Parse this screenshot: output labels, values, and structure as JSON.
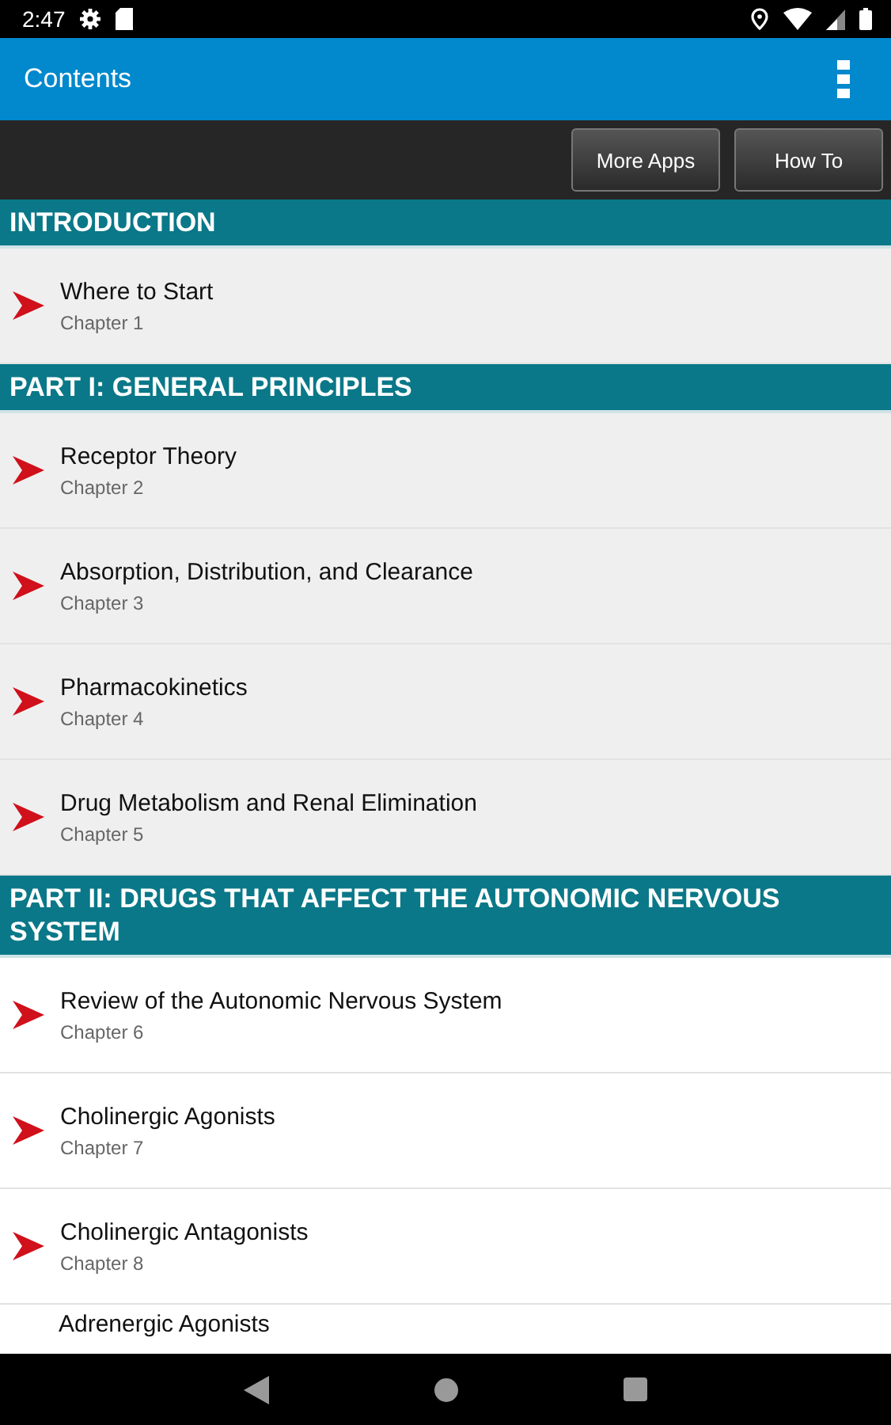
{
  "status_bar": {
    "time": "2:47"
  },
  "app_bar": {
    "title": "Contents"
  },
  "toolbar": {
    "buttons": [
      "More Apps",
      "How To"
    ]
  },
  "sections": [
    {
      "title": "INTRODUCTION",
      "shaded": true,
      "chapters": [
        {
          "title": "Where to Start",
          "subtitle": "Chapter 1"
        }
      ]
    },
    {
      "title": "PART I: GENERAL PRINCIPLES",
      "shaded": true,
      "chapters": [
        {
          "title": "Receptor Theory",
          "subtitle": "Chapter 2"
        },
        {
          "title": "Absorption, Distribution, and Clearance",
          "subtitle": "Chapter 3"
        },
        {
          "title": "Pharmacokinetics",
          "subtitle": "Chapter 4"
        },
        {
          "title": "Drug Metabolism and Renal Elimination",
          "subtitle": "Chapter 5"
        }
      ]
    },
    {
      "title": "PART II: DRUGS THAT AFFECT THE AUTONOMIC NERVOUS SYSTEM",
      "shaded": false,
      "chapters": [
        {
          "title": "Review of the Autonomic Nervous System",
          "subtitle": "Chapter 6"
        },
        {
          "title": "Cholinergic Agonists",
          "subtitle": "Chapter 7"
        },
        {
          "title": "Cholinergic Antagonists",
          "subtitle": "Chapter 8"
        },
        {
          "title": "Adrenergic Agonists"
        }
      ]
    }
  ]
}
